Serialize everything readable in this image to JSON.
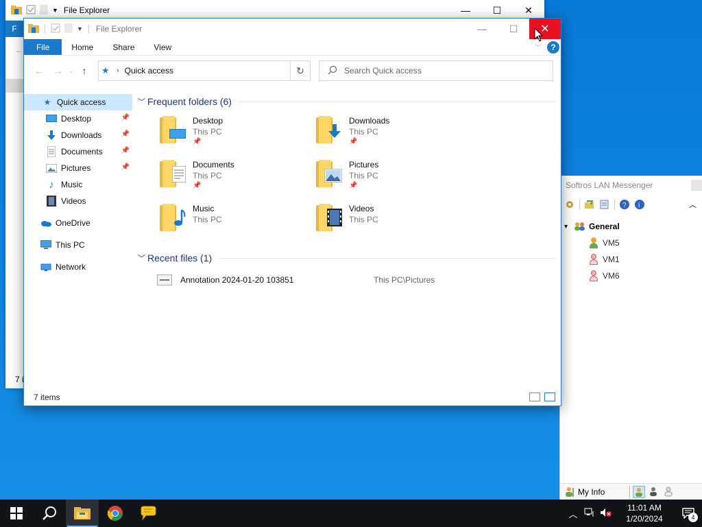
{
  "background_window": {
    "title": "File Explorer",
    "ribbon_file_tab": "F",
    "status_text": "7 i"
  },
  "messenger": {
    "title": "Softros LAN Messenger",
    "group": {
      "name": "General"
    },
    "users": [
      {
        "name": "VM5",
        "status": "online",
        "color": "#e8a33c"
      },
      {
        "name": "VM1",
        "status": "offline",
        "color": "#e06b6b"
      },
      {
        "name": "VM6",
        "status": "offline",
        "color": "#e06b6b"
      }
    ],
    "my_info_label": "My Info"
  },
  "window": {
    "title": "File Explorer",
    "ribbon": {
      "tabs": [
        "File",
        "Home",
        "Share",
        "View"
      ],
      "help_label": "?"
    },
    "address": {
      "location": "Quick access",
      "search_placeholder": "Search Quick access"
    },
    "nav": {
      "items": [
        {
          "label": "Quick access",
          "icon": "star-icon",
          "pinned": false,
          "selected": true
        },
        {
          "label": "Desktop",
          "icon": "desktop-icon",
          "pinned": true
        },
        {
          "label": "Downloads",
          "icon": "download-icon",
          "pinned": true
        },
        {
          "label": "Documents",
          "icon": "document-icon",
          "pinned": true
        },
        {
          "label": "Pictures",
          "icon": "picture-icon",
          "pinned": true
        },
        {
          "label": "Music",
          "icon": "music-icon",
          "pinned": false
        },
        {
          "label": "Videos",
          "icon": "video-icon",
          "pinned": false
        }
      ],
      "onedrive": "OneDrive",
      "this_pc": "This PC",
      "network": "Network"
    },
    "frequent": {
      "heading": "Frequent folders (6)",
      "folders": [
        {
          "name": "Desktop",
          "location": "This PC",
          "pinned": true,
          "overlay": "desktop"
        },
        {
          "name": "Downloads",
          "location": "This PC",
          "pinned": true,
          "overlay": "download"
        },
        {
          "name": "Documents",
          "location": "This PC",
          "pinned": true,
          "overlay": "document"
        },
        {
          "name": "Pictures",
          "location": "This PC",
          "pinned": true,
          "overlay": "picture"
        },
        {
          "name": "Music",
          "location": "This PC",
          "pinned": false,
          "overlay": "music"
        },
        {
          "name": "Videos",
          "location": "This PC",
          "pinned": false,
          "overlay": "video"
        }
      ]
    },
    "recent": {
      "heading": "Recent files (1)",
      "files": [
        {
          "name": "Annotation 2024-01-20 103851",
          "path": "This PC\\Pictures"
        }
      ]
    },
    "status": {
      "item_count": "7 items"
    }
  },
  "taskbar": {
    "time": "11:01 AM",
    "date": "1/20/2024",
    "notification_count": "4",
    "apps": [
      "start",
      "search",
      "file-explorer",
      "chrome",
      "softros-messenger"
    ]
  }
}
